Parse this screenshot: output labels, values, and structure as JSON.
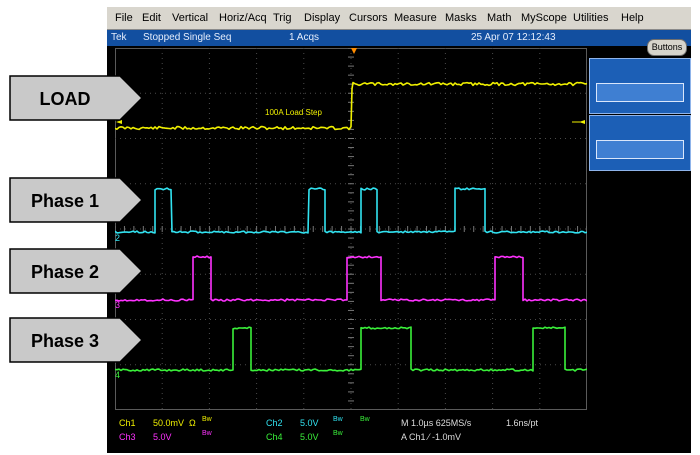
{
  "menu": [
    "File",
    "Edit",
    "Vertical",
    "Horiz/Acq",
    "Trig",
    "Display",
    "Cursors",
    "Measure",
    "Masks",
    "Math",
    "MyScope",
    "Utilities",
    "Help"
  ],
  "status": {
    "brand": "Tek",
    "state": "Stopped  Single Seq",
    "acqs": "1 Acqs",
    "datetime": "25 Apr 07 12:12:43"
  },
  "buttons_label": "Buttons",
  "annotation": "100A Load Step",
  "labels": {
    "load": "LOAD",
    "phase1": "Phase 1",
    "phase2": "Phase 2",
    "phase3": "Phase 3"
  },
  "markers": {
    "ch2": "2",
    "ch3": "3",
    "ch4": "4"
  },
  "readout": {
    "ch1": "Ch1",
    "ch1_scale": "50.0mV",
    "ch1_ohm": "Ω",
    "ch1_bw": "Bw",
    "ch2": "Ch2",
    "ch2_scale": "5.0V",
    "ch2_bw": "Bw",
    "ch3": "Ch3",
    "ch3_scale": "5.0V",
    "ch3_bw": "Bw",
    "ch4": "Ch4",
    "ch4_scale": "5.0V",
    "ch4_bw": "Bw",
    "bw_center": "Bw",
    "timebase": "M 1.0µs 625MS/s",
    "resolution": "1.6ns/pt",
    "trigger": "A  Ch1  ⁄  -1.0mV"
  },
  "colors": {
    "ch1": "#f0f000",
    "ch2": "#31e3f1",
    "ch3": "#ff32ff",
    "ch4": "#3af03a",
    "trigger_marker": "#ff8c00",
    "menubar": "#d9d6ce",
    "statusbar": "#124fa0",
    "panel": "#1c5fb6",
    "label_fill": "#c9c9c9"
  }
}
